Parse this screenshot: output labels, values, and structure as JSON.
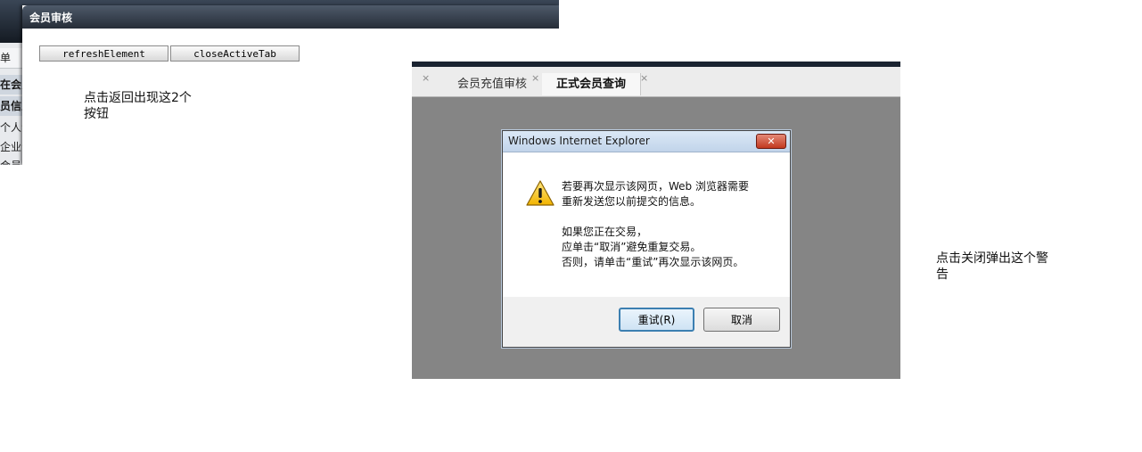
{
  "left_window": {
    "title": "会员审核",
    "buttons": {
      "refresh": "refreshElement",
      "close_tab": "closeActiveTab"
    },
    "note": "点击返回出现这2个\n按钮",
    "background_sidebar": [
      "单",
      "在会员",
      "员信息",
      "个人会",
      "企业会",
      "会员"
    ]
  },
  "tabs": [
    {
      "label": "会员充值审核",
      "active": false
    },
    {
      "label": "正式会员查询",
      "active": true
    }
  ],
  "tab_close_glyph": "×",
  "dialog": {
    "title": "Windows Internet Explorer",
    "close_glyph": "✕",
    "icon": "warning-triangle-icon",
    "lines_1": [
      "若要再次显示该网页，Web 浏览器需要",
      "重新发送您以前提交的信息。"
    ],
    "lines_2": [
      "如果您正在交易，",
      "应单击“取消”避免重复交易。",
      "否则，请单击“重试”再次显示该网页。"
    ],
    "retry_label": "重试(R)",
    "cancel_label": "取消"
  },
  "right_note": "点击关闭弹出这个警\n告"
}
